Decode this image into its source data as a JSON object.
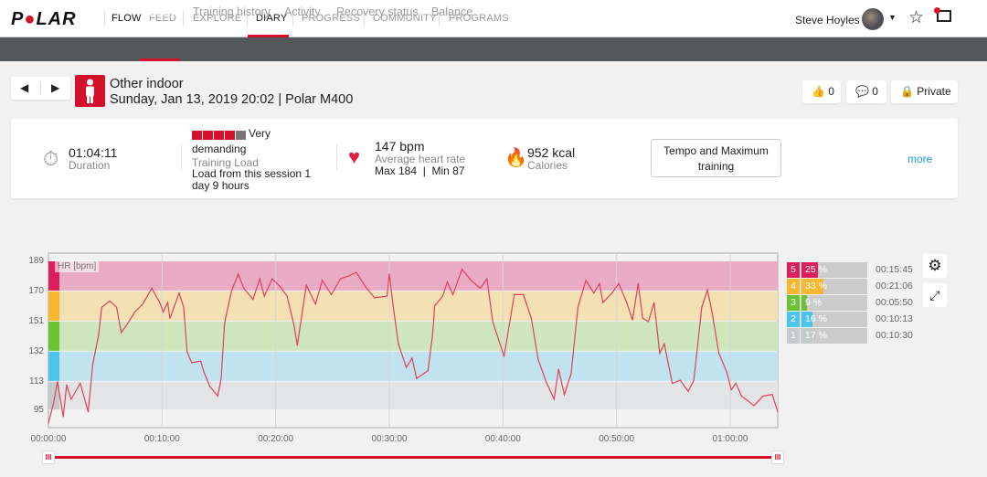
{
  "nav": {
    "logo": "POLAR",
    "flow": "FLOW",
    "items": [
      "FEED",
      "EXPLORE",
      "DIARY",
      "PROGRESS",
      "COMMUNITY",
      "PROGRAMS"
    ],
    "active": "DIARY",
    "user_name": "Steve Hoyles",
    "icons": [
      "star-icon",
      "messages-icon"
    ]
  },
  "subnav": {
    "items": [
      "Diary",
      "Training history",
      "Activity",
      "Recovery status",
      "Balance"
    ],
    "active": "Diary"
  },
  "session": {
    "sport": "Other indoor",
    "subtitle": "Sunday, Jan 13, 2019 20:02 | Polar M400",
    "likes": "0",
    "comments": "0",
    "privacy": "Private"
  },
  "summary": {
    "duration": "01:04:11",
    "duration_label": "Duration",
    "load_level": "Very",
    "load_level2": "demanding",
    "load_bars_filled": 4,
    "load_bars_total": 5,
    "load_label": "Training Load",
    "load_text": "Load from this session 1 day 9 hours",
    "avg_hr": "147 bpm",
    "avg_hr_label": "Average heart rate",
    "hr_minmax": "Max 184  |  Min 87",
    "calories": "952 kcal",
    "calories_label": "Calories",
    "benefit": "Tempo and Maximum training",
    "more": "more",
    "accent": "#d4102a"
  },
  "zones": [
    {
      "zone": "5",
      "percent": 25,
      "percent_label": "25 %",
      "time": "00:15:45",
      "color": "#dc1f5c"
    },
    {
      "zone": "4",
      "percent": 33,
      "percent_label": "33 %",
      "time": "00:21:06",
      "color": "#f7b731"
    },
    {
      "zone": "3",
      "percent": 9,
      "percent_label": "9 %",
      "time": "00:05:50",
      "color": "#6ac235"
    },
    {
      "zone": "2",
      "percent": 16,
      "percent_label": "16 %",
      "time": "00:10:13",
      "color": "#4cc5ec"
    },
    {
      "zone": "1",
      "percent": 17,
      "percent_label": "17 %",
      "time": "00:10:30",
      "color": "#c5cacb"
    }
  ],
  "chart_data": {
    "type": "line",
    "series_label": "HR [bpm]",
    "y_ticks": [
      "189",
      "170",
      "151",
      "132",
      "113",
      "95"
    ],
    "x_ticks": [
      "00:00:00",
      "00:10:00",
      "00:20:00",
      "00:30:00",
      "00:40:00",
      "00:50:00",
      "01:00:00"
    ],
    "xlim": [
      "00:00:00",
      "01:04:11"
    ],
    "ylim": [
      95,
      189
    ],
    "grid": true,
    "zone_bands": [
      {
        "from": 170,
        "to": 189,
        "color": "#e9acc4",
        "marker": "#dc1f5c"
      },
      {
        "from": 151,
        "to": 170,
        "color": "#f3e1b4",
        "marker": "#f7b731"
      },
      {
        "from": 132,
        "to": 151,
        "color": "#cfe6bc",
        "marker": "#6ac235"
      },
      {
        "from": 113,
        "to": 132,
        "color": "#c0e3ef",
        "marker": "#4cc5ec"
      },
      {
        "from": 95,
        "to": 113,
        "color": "#e2e4e5",
        "marker": "#c5cacb"
      }
    ],
    "line_color": "#e0405c",
    "points": [
      [
        "00:00:00",
        87
      ],
      [
        "00:00:24",
        98
      ],
      [
        "00:00:48",
        113
      ],
      [
        "00:01:18",
        91
      ],
      [
        "00:01:36",
        111
      ],
      [
        "00:02:00",
        102
      ],
      [
        "00:02:48",
        112
      ],
      [
        "00:03:30",
        94
      ],
      [
        "00:03:54",
        124
      ],
      [
        "00:04:24",
        142
      ],
      [
        "00:04:42",
        160
      ],
      [
        "00:05:24",
        164
      ],
      [
        "00:06:00",
        160
      ],
      [
        "00:06:24",
        144
      ],
      [
        "00:07:00",
        150
      ],
      [
        "00:07:36",
        157
      ],
      [
        "00:08:18",
        162
      ],
      [
        "00:09:06",
        172
      ],
      [
        "00:09:48",
        163
      ],
      [
        "00:10:06",
        157
      ],
      [
        "00:10:30",
        163
      ],
      [
        "00:10:42",
        153
      ],
      [
        "00:11:30",
        169
      ],
      [
        "00:11:54",
        160
      ],
      [
        "00:12:12",
        132
      ],
      [
        "00:12:36",
        125
      ],
      [
        "00:13:24",
        126
      ],
      [
        "00:13:42",
        119
      ],
      [
        "00:14:12",
        110
      ],
      [
        "00:14:54",
        104
      ],
      [
        "00:15:12",
        115
      ],
      [
        "00:15:30",
        150
      ],
      [
        "00:16:06",
        170
      ],
      [
        "00:16:42",
        181
      ],
      [
        "00:17:12",
        172
      ],
      [
        "00:18:00",
        165
      ],
      [
        "00:18:36",
        178
      ],
      [
        "00:19:00",
        167
      ],
      [
        "00:19:42",
        178
      ],
      [
        "00:20:24",
        173
      ],
      [
        "00:21:00",
        167
      ],
      [
        "00:21:36",
        149
      ],
      [
        "00:21:54",
        136
      ],
      [
        "00:22:42",
        174
      ],
      [
        "00:23:30",
        162
      ],
      [
        "00:24:06",
        177
      ],
      [
        "00:24:54",
        168
      ],
      [
        "00:25:42",
        178
      ],
      [
        "00:26:30",
        180
      ],
      [
        "00:27:06",
        182
      ],
      [
        "00:27:54",
        173
      ],
      [
        "00:28:42",
        166
      ],
      [
        "00:29:48",
        167
      ],
      [
        "00:30:00",
        181
      ],
      [
        "00:30:18",
        163
      ],
      [
        "00:30:48",
        137
      ],
      [
        "00:31:30",
        122
      ],
      [
        "00:32:00",
        128
      ],
      [
        "00:32:24",
        115
      ],
      [
        "00:33:24",
        120
      ],
      [
        "00:33:48",
        142
      ],
      [
        "00:34:00",
        161
      ],
      [
        "00:34:42",
        167
      ],
      [
        "00:35:06",
        176
      ],
      [
        "00:35:36",
        168
      ],
      [
        "00:36:24",
        184
      ],
      [
        "00:37:12",
        177
      ],
      [
        "00:38:00",
        172
      ],
      [
        "00:38:36",
        178
      ],
      [
        "00:39:06",
        151
      ],
      [
        "00:40:06",
        129
      ],
      [
        "00:41:00",
        168
      ],
      [
        "00:41:48",
        168
      ],
      [
        "00:42:30",
        153
      ],
      [
        "00:43:06",
        127
      ],
      [
        "00:43:48",
        113
      ],
      [
        "00:44:30",
        102
      ],
      [
        "00:44:54",
        121
      ],
      [
        "00:45:24",
        105
      ],
      [
        "00:46:00",
        118
      ],
      [
        "00:46:36",
        160
      ],
      [
        "00:47:18",
        177
      ],
      [
        "00:48:00",
        169
      ],
      [
        "00:48:30",
        175
      ],
      [
        "00:48:48",
        163
      ],
      [
        "00:49:36",
        169
      ],
      [
        "00:50:12",
        175
      ],
      [
        "00:50:54",
        163
      ],
      [
        "00:51:24",
        152
      ],
      [
        "00:51:54",
        175
      ],
      [
        "00:52:18",
        153
      ],
      [
        "00:52:48",
        151
      ],
      [
        "00:53:18",
        163
      ],
      [
        "00:53:48",
        131
      ],
      [
        "00:54:12",
        137
      ],
      [
        "00:54:54",
        112
      ],
      [
        "00:55:36",
        114
      ],
      [
        "00:56:18",
        107
      ],
      [
        "00:56:48",
        114
      ],
      [
        "00:57:30",
        160
      ],
      [
        "00:58:00",
        171
      ],
      [
        "00:58:24",
        157
      ],
      [
        "00:59:00",
        131
      ],
      [
        "00:59:42",
        119
      ],
      [
        "01:00:06",
        108
      ],
      [
        "01:00:30",
        112
      ],
      [
        "01:01:00",
        104
      ],
      [
        "01:02:06",
        98
      ],
      [
        "01:02:54",
        104
      ],
      [
        "01:03:42",
        105
      ],
      [
        "01:04:11",
        94
      ]
    ]
  }
}
